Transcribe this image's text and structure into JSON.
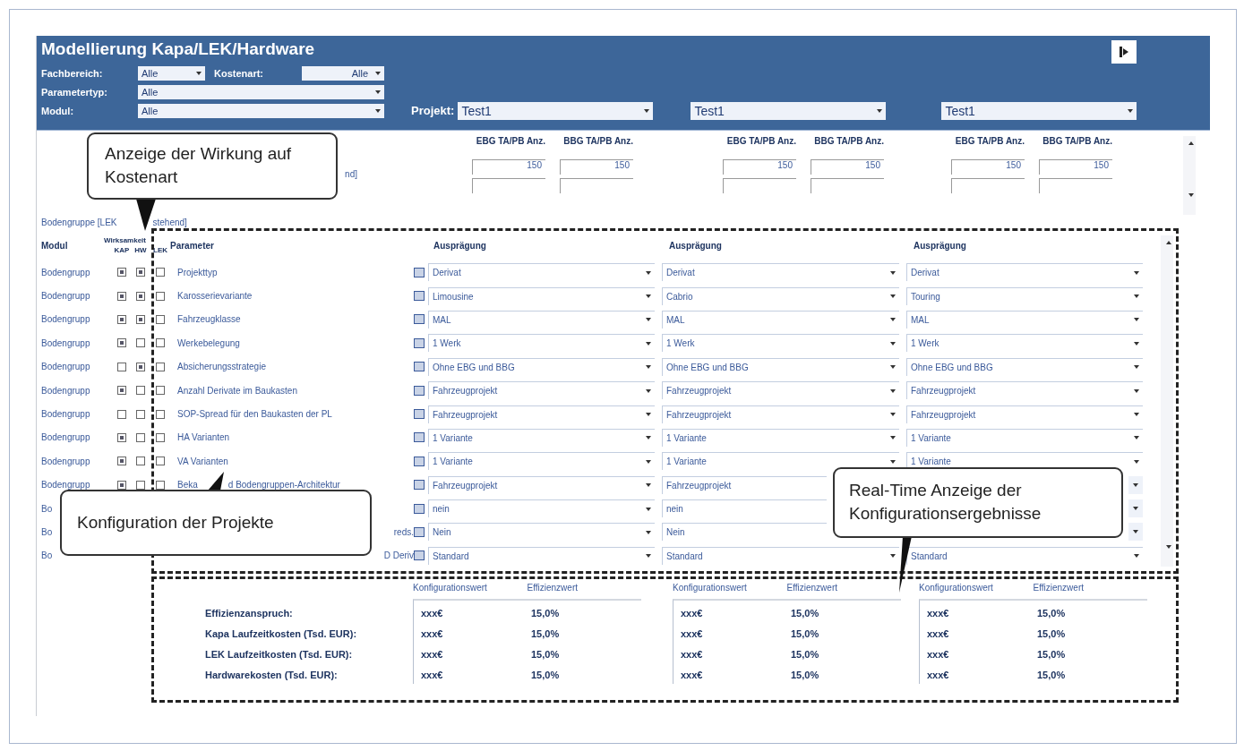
{
  "header": {
    "title": "Modellierung Kapa/LEK/Hardware",
    "filters": [
      {
        "label": "Fachbereich:",
        "value": "Alle"
      },
      {
        "label": "Kostenart:",
        "value": "Alle"
      },
      {
        "label": "Parametertyp:",
        "value": "Alle"
      },
      {
        "label": "Modul:",
        "value": "Alle"
      }
    ],
    "project_label": "Projekt:",
    "projects": [
      "Test1",
      "Test1",
      "Test1"
    ]
  },
  "top_section": {
    "row_label_tail": "nd]",
    "group_label_parts": [
      "Bodengruppe [LEK",
      "stehend]"
    ],
    "projects": [
      {
        "columns": [
          {
            "heading": "EBG TA/PB Anz.",
            "value": "150"
          },
          {
            "heading": "BBG TA/PB Anz.",
            "value": "150"
          }
        ]
      },
      {
        "columns": [
          {
            "heading": "EBG TA/PB Anz.",
            "value": "150"
          },
          {
            "heading": "BBG TA/PB Anz.",
            "value": "150"
          }
        ]
      },
      {
        "columns": [
          {
            "heading": "EBG TA/PB Anz.",
            "value": "150"
          },
          {
            "heading": "BBG TA/PB Anz.",
            "value": "150"
          }
        ]
      }
    ]
  },
  "table": {
    "columns": {
      "module": "Modul",
      "effect": "Wirksamkeit",
      "effect_sub": [
        "KAP",
        "HW",
        "LEK"
      ],
      "parameter": "Parameter",
      "value": [
        "Ausprägung",
        "Ausprägung",
        "Ausprägung"
      ]
    },
    "rows": [
      {
        "module": "Bodengrupp",
        "effects": [
          true,
          true,
          false
        ],
        "parameter": "Projekttyp",
        "values": [
          "Derivat",
          "Derivat",
          "Derivat"
        ]
      },
      {
        "module": "Bodengrupp",
        "effects": [
          true,
          true,
          false
        ],
        "parameter": "Karosserievariante",
        "values": [
          "Limousine",
          "Cabrio",
          "Touring"
        ]
      },
      {
        "module": "Bodengrupp",
        "effects": [
          true,
          true,
          false
        ],
        "parameter": "Fahrzeugklasse",
        "values": [
          "MAL",
          "MAL",
          "MAL"
        ]
      },
      {
        "module": "Bodengrupp",
        "effects": [
          true,
          false,
          false
        ],
        "parameter": "Werkebelegung",
        "values": [
          "1 Werk",
          "1 Werk",
          "1 Werk"
        ]
      },
      {
        "module": "Bodengrupp",
        "effects": [
          false,
          true,
          false
        ],
        "parameter": "Absicherungsstrategie",
        "values": [
          "Ohne EBG und BBG",
          "Ohne EBG und BBG",
          "Ohne EBG und BBG"
        ]
      },
      {
        "module": "Bodengrupp",
        "effects": [
          true,
          false,
          false
        ],
        "parameter": "Anzahl Derivate im Baukasten",
        "values": [
          "Fahrzeugprojekt",
          "Fahrzeugprojekt",
          "Fahrzeugprojekt"
        ]
      },
      {
        "module": "Bodengrupp",
        "effects": [
          false,
          false,
          false
        ],
        "parameter": "SOP-Spread für den Baukasten der PL",
        "values": [
          "Fahrzeugprojekt",
          "Fahrzeugprojekt",
          "Fahrzeugprojekt"
        ]
      },
      {
        "module": "Bodengrupp",
        "effects": [
          true,
          false,
          false
        ],
        "parameter": "HA Varianten",
        "values": [
          "1 Variante",
          "1 Variante",
          "1 Variante"
        ]
      },
      {
        "module": "Bodengrupp",
        "effects": [
          true,
          false,
          false
        ],
        "parameter": "VA Varianten",
        "values": [
          "1 Variante",
          "1 Variante",
          "1 Variante"
        ]
      },
      {
        "module": "Bodengrupp",
        "effects": [
          true,
          false,
          false
        ],
        "parameter_parts": [
          "Beka",
          "d Bodengruppen-Architektur"
        ],
        "values": [
          "Fahrzeugprojekt",
          "Fahrzeugprojekt"
        ]
      },
      {
        "module": "Bo",
        "values": [
          "nein",
          "nein"
        ]
      },
      {
        "module": "Bo",
        "parameter_tail": "reds.",
        "values": [
          "Nein",
          "Nein"
        ]
      },
      {
        "module": "Bo",
        "parameter_tail": "D Deriv",
        "values": [
          "Standard",
          "Standard",
          "Standard"
        ]
      }
    ]
  },
  "results": {
    "labels": [
      "Effizienzanspruch:",
      "Kapa Laufzeitkosten (Tsd. EUR):",
      "LEK Laufzeitkosten (Tsd. EUR):",
      "Hardwarekosten (Tsd. EUR):"
    ],
    "projects": [
      {
        "headings": [
          "Konfigurationswert",
          "Effizienzwert"
        ],
        "rows": [
          [
            "xxx€",
            "15,0%"
          ],
          [
            "xxx€",
            "15,0%"
          ],
          [
            "xxx€",
            "15,0%"
          ],
          [
            "xxx€",
            "15,0%"
          ]
        ]
      },
      {
        "headings": [
          "Konfigurationswert",
          "Effizienzwert"
        ],
        "rows": [
          [
            "xxx€",
            "15,0%"
          ],
          [
            "xxx€",
            "15,0%"
          ],
          [
            "xxx€",
            "15,0%"
          ],
          [
            "xxx€",
            "15,0%"
          ]
        ]
      },
      {
        "headings": [
          "Konfigurationswert",
          "Effizienzwert"
        ],
        "rows": [
          [
            "xxx€",
            "15,0%"
          ],
          [
            "xxx€",
            "15,0%"
          ],
          [
            "xxx€",
            "15,0%"
          ],
          [
            "xxx€",
            "15,0%"
          ]
        ]
      }
    ]
  },
  "callouts": [
    {
      "text": "Anzeige der Wirkung auf Kostenart"
    },
    {
      "text": "Konfiguration der Projekte"
    },
    {
      "text": "Real-Time Anzeige der Konfigurationsergebnisse"
    }
  ]
}
